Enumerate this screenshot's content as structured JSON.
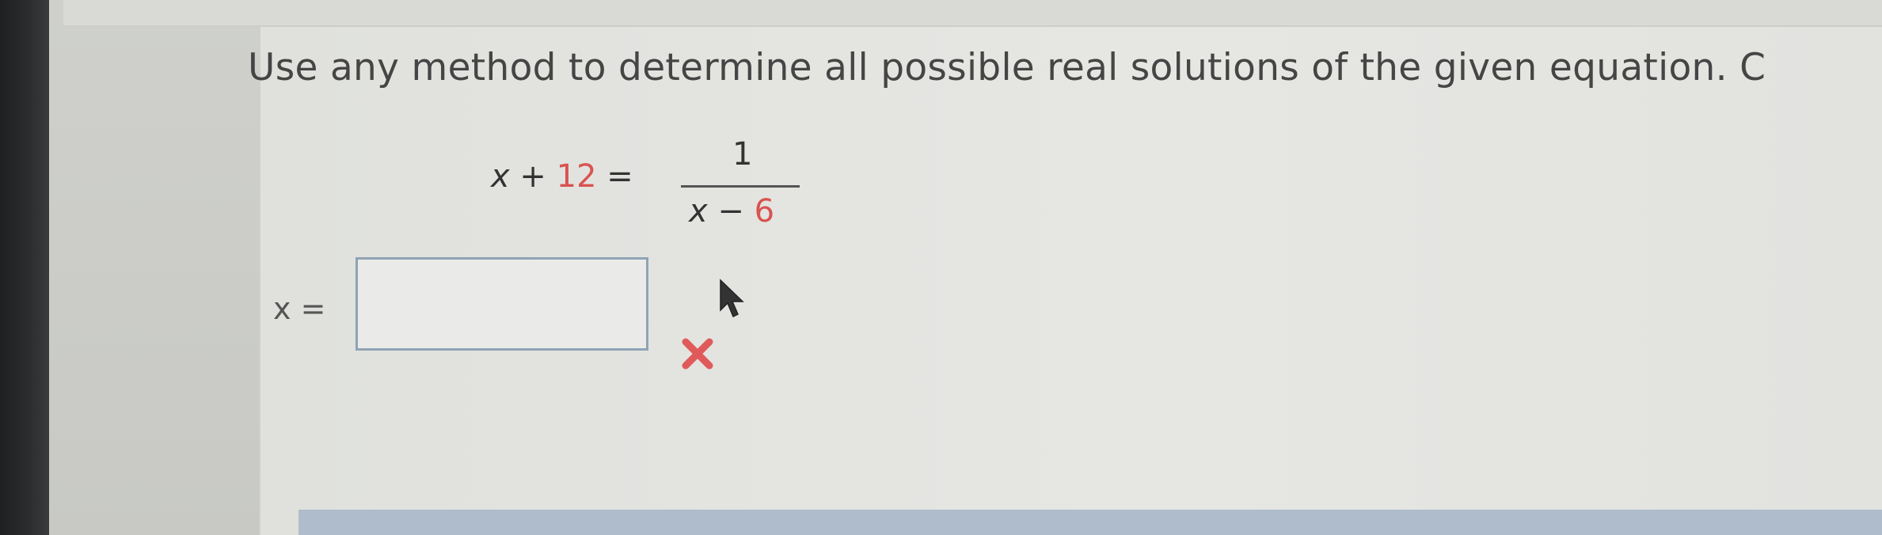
{
  "question": {
    "prompt": "Use any method to determine all possible real solutions of the given equation. C"
  },
  "equation": {
    "lhs_var": "x",
    "lhs_op": "+",
    "lhs_const": "12",
    "equals": "=",
    "numerator": "1",
    "den_var": "x",
    "den_op": "−",
    "den_const": "6"
  },
  "answer": {
    "label": "x =",
    "value": "",
    "status": "incorrect"
  },
  "colors": {
    "number_color": "#d9534f",
    "incorrect_mark": "#e05a5a",
    "input_border": "#8fa3b5"
  },
  "icons": {
    "status_icon": "x-mark-icon",
    "pointer": "mouse-cursor-icon"
  }
}
